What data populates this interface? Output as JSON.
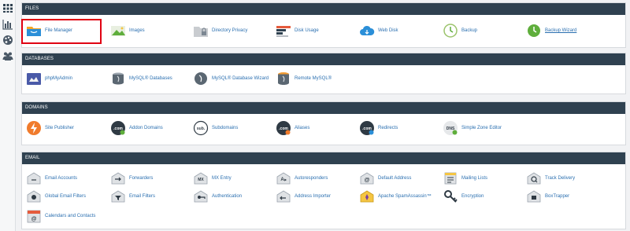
{
  "sections": {
    "files": {
      "title": "FILES",
      "items": [
        {
          "label": "File Manager",
          "icon": "file-manager-icon"
        },
        {
          "label": "Images",
          "icon": "images-icon"
        },
        {
          "label": "Directory Privacy",
          "icon": "directory-privacy-icon"
        },
        {
          "label": "Disk Usage",
          "icon": "disk-usage-icon"
        },
        {
          "label": "Web Disk",
          "icon": "web-disk-icon"
        },
        {
          "label": "Backup",
          "icon": "backup-icon"
        },
        {
          "label": "Backup Wizard",
          "icon": "backup-wizard-icon"
        }
      ]
    },
    "databases": {
      "title": "DATABASES",
      "items": [
        {
          "label": "phpMyAdmin",
          "icon": "phpmyadmin-icon"
        },
        {
          "label": "MySQL® Databases",
          "icon": "mysql-databases-icon"
        },
        {
          "label": "MySQL® Database Wizard",
          "icon": "mysql-database-wizard-icon"
        },
        {
          "label": "Remote MySQL®",
          "icon": "remote-mysql-icon"
        }
      ]
    },
    "domains": {
      "title": "DOMAINS",
      "items": [
        {
          "label": "Site Publisher",
          "icon": "site-publisher-icon"
        },
        {
          "label": "Addon Domains",
          "icon": "addon-domains-icon",
          "glyph": ".com"
        },
        {
          "label": "Subdomains",
          "icon": "subdomains-icon",
          "glyph": "sub."
        },
        {
          "label": "Aliases",
          "icon": "aliases-icon",
          "glyph": ".com"
        },
        {
          "label": "Redirects",
          "icon": "redirects-icon",
          "glyph": ".com"
        },
        {
          "label": "Simple Zone Editor",
          "icon": "simple-zone-editor-icon",
          "glyph": "DNS"
        }
      ]
    },
    "email": {
      "title": "EMAIL",
      "items": [
        {
          "label": "Email Accounts",
          "icon": "email-accounts-icon"
        },
        {
          "label": "Forwarders",
          "icon": "forwarders-icon"
        },
        {
          "label": "MX Entry",
          "icon": "mx-entry-icon",
          "glyph": "MX"
        },
        {
          "label": "Autoresponders",
          "icon": "autoresponders-icon",
          "glyph": "A"
        },
        {
          "label": "Default Address",
          "icon": "default-address-icon",
          "glyph": "@"
        },
        {
          "label": "Mailing Lists",
          "icon": "mailing-lists-icon"
        },
        {
          "label": "Track Delivery",
          "icon": "track-delivery-icon"
        },
        {
          "label": "Global Email Filters",
          "icon": "global-email-filters-icon"
        },
        {
          "label": "Email Filters",
          "icon": "email-filters-icon"
        },
        {
          "label": "Authentication",
          "icon": "authentication-icon"
        },
        {
          "label": "Address Importer",
          "icon": "address-importer-icon"
        },
        {
          "label": "Apache SpamAssassin™",
          "icon": "spamassassin-icon"
        },
        {
          "label": "Encryption",
          "icon": "encryption-icon"
        },
        {
          "label": "BoxTrapper",
          "icon": "boxtrapper-icon"
        },
        {
          "label": "Calendars and Contacts",
          "icon": "calendars-contacts-icon",
          "glyph": "@"
        }
      ]
    }
  },
  "rail": [
    "grid-icon",
    "stats-icon",
    "palette-icon",
    "users-icon"
  ],
  "colors": {
    "header": "#2f4150",
    "link": "#2a6fb0",
    "highlight": "#e00012"
  }
}
